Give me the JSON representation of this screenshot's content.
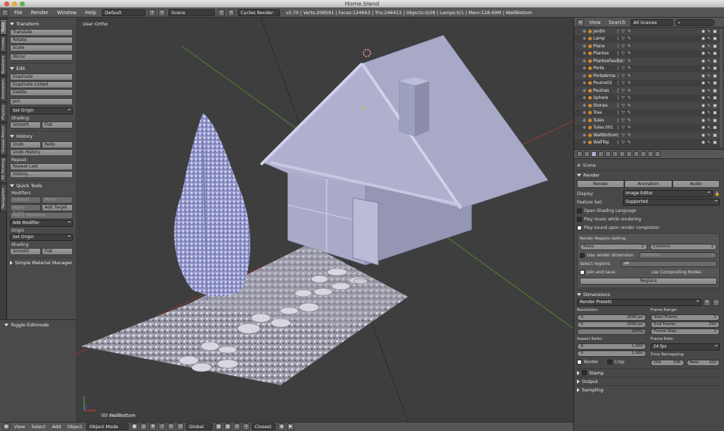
{
  "window": {
    "title": "Home.blend"
  },
  "menubar": {
    "items": [
      "File",
      "Render",
      "Window",
      "Help"
    ],
    "screen_layout": "Default",
    "scene": "Scene",
    "render_engine": "Cycles Render",
    "stats": "v2.70 | Verts:208591 | Faces:124663 | Tris:246413 | Objects:0/28 | Lamps:0/1 | Mem:128.69M | WallBottom"
  },
  "left_tabs": [
    "Tools",
    "Create",
    "Relations",
    "Animation",
    "Physics",
    "Grease Pencil",
    "3D Printing",
    "Navigation"
  ],
  "tool_shelf": {
    "transform": {
      "title": "Transform",
      "translate": "Translate",
      "rotate": "Rotate",
      "scale": "Scale",
      "mirror": "Mirror"
    },
    "edit": {
      "title": "Edit",
      "duplicate": "Duplicate",
      "duplicate_linked": "Duplicate Linked",
      "delete": "Delete",
      "join": "Join",
      "set_origin": "Set Origin",
      "shading_label": "Shading:",
      "smooth": "Smooth",
      "flat": "Flat"
    },
    "history": {
      "title": "History",
      "undo": "Undo",
      "redo": "Redo",
      "undo_history": "Undo History",
      "repeat_label": "Repeat:",
      "repeat_last": "Repeat Last",
      "history": "History..."
    },
    "quick_tools": {
      "title": "Quick Tools",
      "modifiers_label": "Modifiers",
      "subsurf": "Subsurf",
      "mirror": "Mirror",
      "apply_subd": "Apply Subd...",
      "add_target": "Add Target",
      "apply_modifiers": "Apply Modifiers",
      "add_modifier": "Add Modifier",
      "origin_label": "Origin",
      "set_origin": "Set Origin",
      "shading_label": "Shading",
      "smooth": "Smooth",
      "flat": "Flat"
    },
    "simple_material_manager": "Simple Material Manager"
  },
  "operator_panel": {
    "title": "Toggle Editmode"
  },
  "viewport": {
    "view_label": "User Ortho",
    "active_object": "(0) WallBottom"
  },
  "bottombar": {
    "items": [
      "View",
      "Select",
      "Add",
      "Object"
    ],
    "mode": "Object Mode",
    "orientation": "Global",
    "snap": "Closest"
  },
  "outliner": {
    "header": {
      "view": "View",
      "search": "Search",
      "filter": "All Scenes"
    },
    "items": [
      "Jardin",
      "Lamp",
      "Plane",
      "Plantes",
      "PlantesFeuille",
      "Porte",
      "PorteArma",
      "Poutre02",
      "Poutres",
      "Sphere",
      "Stones",
      "Tree",
      "Tules",
      "Tules.001",
      "WallBottom",
      "WallTop"
    ]
  },
  "properties": {
    "context": "Scene",
    "render": {
      "title": "Render",
      "buttons": [
        "Render",
        "Animation",
        "Audio"
      ],
      "display_label": "Display:",
      "display_value": "Image Editor",
      "feature_label": "Feature Set:",
      "feature_value": "Supported",
      "open_shading": "Open Shading Language",
      "play_music": "Play music while rendering",
      "play_sound": "Play sound upon render completion",
      "regions_title": "Render Regions Setting:",
      "rows_label": "Rows:",
      "rows_value": "1",
      "cols_label": "Columns:",
      "cols_value": "1",
      "use_dim": "Use render dimension",
      "multiplier": "Multiplier",
      "multiplier_value": "1",
      "select_regions": "Select regions:",
      "select_value": "all",
      "join_save": "Join and save",
      "use_comp": "use Compositing Nodes",
      "regions_btn": "Regions"
    },
    "dimensions": {
      "title": "Dimensions",
      "presets": "Render Presets",
      "resolution": "Resolution:",
      "res_x_label": "X:",
      "res_x": "2000 px",
      "res_y_label": "Y:",
      "res_y": "2000 px",
      "res_pct": "100%",
      "frame_range": "Frame Range:",
      "start_label": "Start Frame:",
      "start": "1",
      "end_label": "End Frame:",
      "end": "250",
      "step_label": "Frame Step:",
      "step": "1",
      "aspect": "Aspect Ratio:",
      "asp_x_label": "X:",
      "asp_x": "1.000",
      "asp_y_label": "Y:",
      "asp_y": "1.000",
      "frame_rate": "Frame Rate:",
      "fps": "24 fps",
      "time_remap": "Time Remapping:",
      "old_label": "Old:",
      "old": "100",
      "new_label": "New:",
      "new": "100",
      "border": "Border",
      "crop": "Crop"
    },
    "collapsed": [
      "Stamp",
      "Output",
      "Sampling"
    ]
  },
  "colors": {
    "accent": "#d88a2a",
    "house": "#b3b5d2",
    "grid_x": "#b04040",
    "grid_y": "#5a9a3a"
  }
}
